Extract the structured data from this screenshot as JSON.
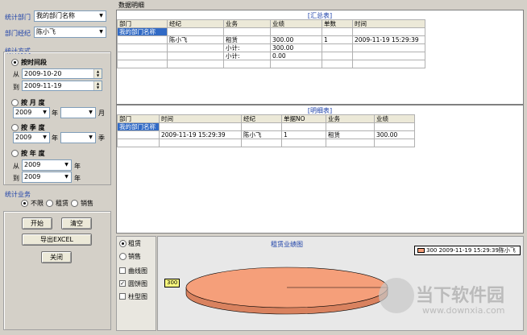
{
  "filters": {
    "dept_label": "统计部门",
    "dept_value": "我的部门名称",
    "agent_label": "部门经纪",
    "agent_value": "陈小飞",
    "method_label": "统计方式",
    "by_period_label": "按时间段",
    "from_label": "从",
    "from_date": "2009-10-20",
    "to_label": "到",
    "to_date": "2009-11-19",
    "by_month_label": "按 月 度",
    "month_year": "2009",
    "year_unit": "年",
    "month_value": "",
    "month_unit": "月",
    "by_quarter_label": "按 季 度",
    "quarter_year": "2009",
    "quarter_value": "",
    "quarter_unit": "季",
    "by_year_label": "按 年 度",
    "year_from_label": "从",
    "year_from": "2009",
    "year_to_label": "到",
    "year_to": "2009",
    "business_label": "统计业务",
    "biz_all": "不限",
    "biz_rent": "租赁",
    "biz_sale": "销售"
  },
  "buttons": {
    "start": "开始",
    "clear": "清空",
    "export": "导出EXCEL",
    "close": "关闭"
  },
  "panel_title": "数据明细",
  "summary": {
    "caption": "[汇总表]",
    "headers": [
      "部门",
      "经纪",
      "业务",
      "业绩",
      "单数",
      "时间"
    ],
    "rows": [
      [
        "我的部门名称",
        "",
        "",
        "",
        "",
        ""
      ],
      [
        "",
        "陈小飞",
        "租赁",
        "300.00",
        "1",
        "2009-11-19 15:29:39"
      ],
      [
        "",
        "",
        "小计:",
        "300.00",
        "",
        ""
      ],
      [
        "",
        "",
        "小计:",
        "0.00",
        "",
        ""
      ],
      [
        "",
        "",
        "",
        "",
        "",
        ""
      ]
    ]
  },
  "detail": {
    "caption": "[明细表]",
    "headers": [
      "部门",
      "时间",
      "经纪",
      "单据NO",
      "业务",
      "业绩"
    ],
    "rows": [
      [
        "我的部门名称",
        "",
        "",
        "",
        "",
        ""
      ],
      [
        "",
        "2009-11-19 15:29:39",
        "陈小飞",
        "1",
        "租赁",
        "300.00"
      ],
      [
        "",
        "",
        "",
        "",
        "",
        ""
      ]
    ]
  },
  "chart_options": {
    "rent": "租赁",
    "sale": "销售",
    "line": "曲线图",
    "pie": "圆饼图",
    "bar": "柱型图"
  },
  "chart_data": {
    "type": "pie",
    "title": "租赁业绩图",
    "slices": [
      {
        "label": "300 2009-11-19 15:29:39陈小飞",
        "value": 300,
        "color": "#f59f7a"
      }
    ],
    "value_tag": "300"
  },
  "watermark": {
    "text1": "当下软件园",
    "text2": "www.downxia.com"
  }
}
